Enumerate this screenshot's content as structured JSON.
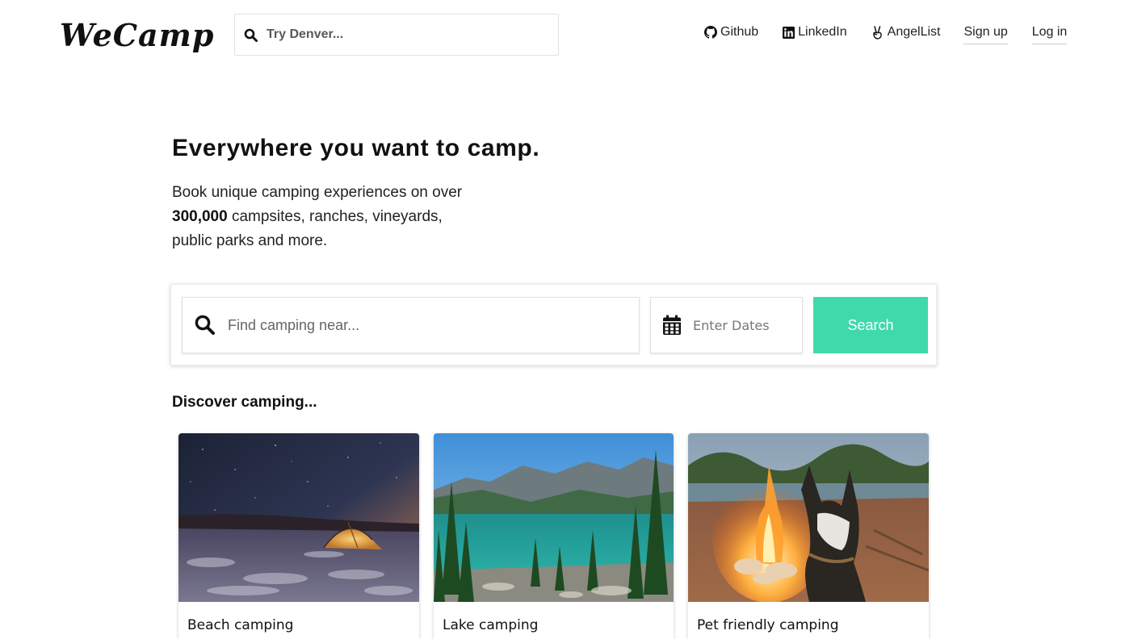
{
  "brand": {
    "logo_text": "WeCamp"
  },
  "header": {
    "search": {
      "placeholder": "Try Denver...",
      "icon": "search-icon"
    },
    "nav": [
      {
        "label": "Github",
        "icon": "github-icon"
      },
      {
        "label": "LinkedIn",
        "icon": "linkedin-icon"
      },
      {
        "label": "AngelList",
        "icon": "angellist-icon"
      },
      {
        "label": "Sign up"
      },
      {
        "label": "Log in"
      }
    ]
  },
  "hero": {
    "title": "Everywhere you want to camp.",
    "subtitle_line1": "Book unique camping experiences on over",
    "subtitle_count": "300,000",
    "subtitle_line2_rest": " campsites, ranches, vineyards,",
    "subtitle_line3": "public parks and more."
  },
  "search_card": {
    "location_placeholder": "Find camping near...",
    "dates_placeholder": "Enter Dates",
    "button_label": "Search",
    "button_color": "#40d9ac"
  },
  "discover": {
    "title": "Discover camping...",
    "cards": [
      {
        "label": "Beach camping",
        "image": "night tent on beach"
      },
      {
        "label": "Lake camping",
        "image": "mountain lake"
      },
      {
        "label": "Pet friendly camping",
        "image": "dog by campfire"
      }
    ]
  }
}
